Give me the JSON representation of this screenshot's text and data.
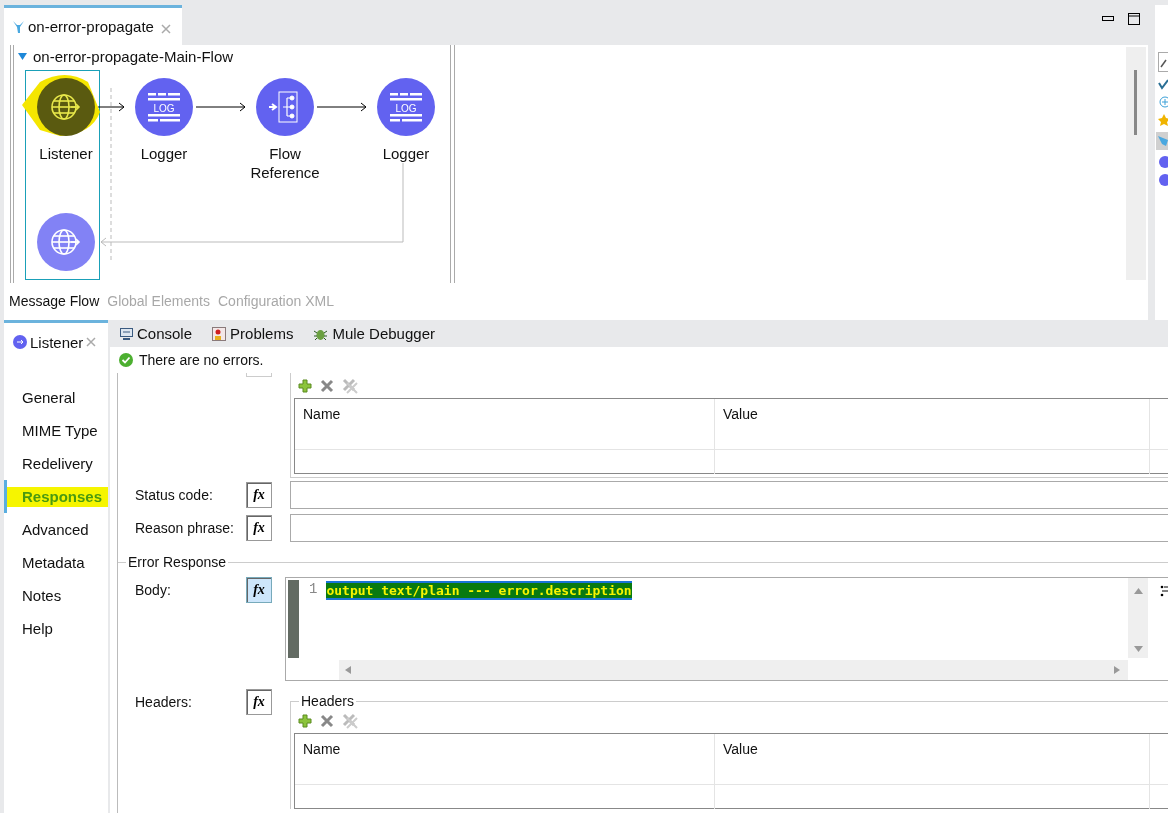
{
  "editor_tab": {
    "title": "on-error-propagate",
    "selected": true
  },
  "flow": {
    "name": "on-error-propagate-Main-Flow",
    "expanded": true,
    "nodes": [
      {
        "kind": "listener",
        "label": "Listener",
        "highlighted": true
      },
      {
        "kind": "logger",
        "label": "Logger",
        "badge": "LOG",
        "highlighted": false
      },
      {
        "kind": "flow-reference",
        "label": "Flow Reference",
        "highlighted": false
      },
      {
        "kind": "logger",
        "label": "Logger",
        "badge": "LOG",
        "highlighted": false
      },
      {
        "kind": "response",
        "highlighted": false
      }
    ]
  },
  "editor_views": [
    {
      "label": "Message Flow",
      "selected": true
    },
    {
      "label": "Global Elements",
      "selected": false
    },
    {
      "label": "Configuration XML",
      "selected": false
    }
  ],
  "properties_tab": {
    "title": "Listener"
  },
  "view_tabs": [
    {
      "kind": "console",
      "label": "Console"
    },
    {
      "kind": "problems",
      "label": "Problems"
    },
    {
      "kind": "debugger",
      "label": "Mule Debugger"
    }
  ],
  "status": "There are no errors.",
  "nav_items": [
    {
      "label": "General",
      "selected": false
    },
    {
      "label": "MIME Type",
      "selected": false
    },
    {
      "label": "Redelivery",
      "selected": false
    },
    {
      "label": "Responses",
      "selected": true
    },
    {
      "label": "Advanced",
      "selected": false
    },
    {
      "label": "Metadata",
      "selected": false
    },
    {
      "label": "Notes",
      "selected": false
    },
    {
      "label": "Help",
      "selected": false
    }
  ],
  "top_table": {
    "columns": [
      "Name",
      "Value"
    ]
  },
  "fields": [
    {
      "label": "Status code:",
      "fx": "fx"
    },
    {
      "label": "Reason phrase:",
      "fx": "fx"
    }
  ],
  "error_response": {
    "title": "Error Response",
    "body_label": "Body:",
    "body_fx": "fx",
    "line_number": "1",
    "code": "output text/plain --- error.description",
    "code_selected": true,
    "headers_label": "Headers:",
    "headers_fx": "fx",
    "headers_group": "Headers",
    "columns": [
      "Name",
      "Value"
    ]
  }
}
